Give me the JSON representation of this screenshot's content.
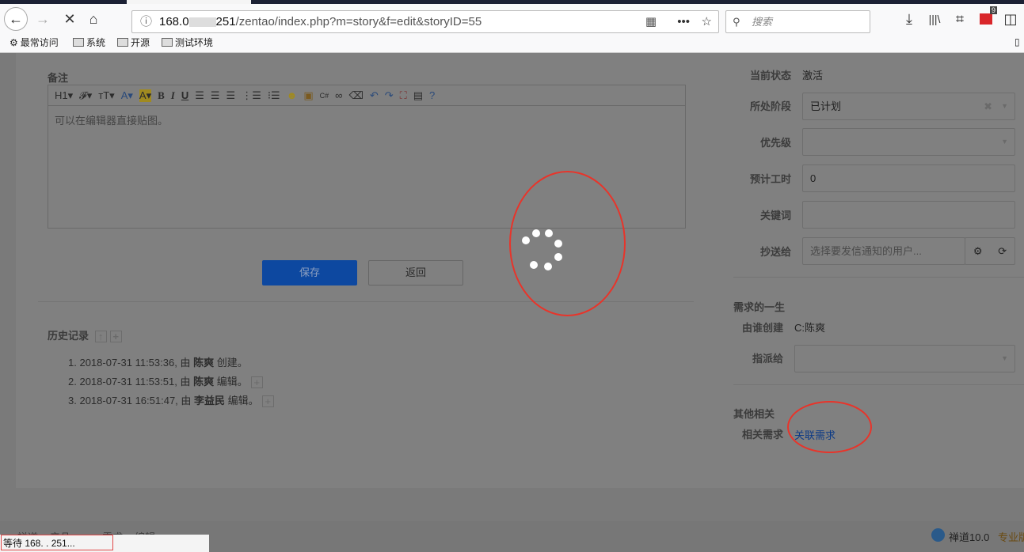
{
  "browser": {
    "url_host": "168.0",
    "url_host_end": "251",
    "url_path": "/zentao/index.php?m=story&f=edit&storyID=55",
    "search_placeholder": "搜索",
    "badge": "9",
    "bookmarks": [
      "最常访问",
      "系统",
      "开源",
      "测试环境"
    ],
    "status_text": "等待 168.   .  251..."
  },
  "editor": {
    "label": "备注",
    "placeholder": "可以在编辑器直接贴图。",
    "toolbar": [
      "H1▾",
      "𝓕▾",
      "тT▾",
      "A▾",
      "A▾",
      "B",
      "I",
      "U"
    ]
  },
  "buttons": {
    "save": "保存",
    "back": "返回"
  },
  "history": {
    "title": "历史记录",
    "items": [
      {
        "n": "1.",
        "time": "2018-07-31 11:53:36, 由",
        "user": "陈爽",
        "action": "创建。"
      },
      {
        "n": "2.",
        "time": "2018-07-31 11:53:51, 由",
        "user": "陈爽",
        "action": "编辑。"
      },
      {
        "n": "3.",
        "time": "2018-07-31 16:51:47, 由",
        "user": "李益民",
        "action": "编辑。"
      }
    ]
  },
  "side": {
    "status_label": "当前状态",
    "status_value": "激活",
    "stage_label": "所处阶段",
    "stage_value": "已计划",
    "priority_label": "优先级",
    "estimate_label": "预计工时",
    "estimate_value": "0",
    "keywords_label": "关键词",
    "mailto_label": "抄送给",
    "mailto_placeholder": "选择要发信通知的用户...",
    "life_title": "需求的一生",
    "creator_label": "由谁创建",
    "creator_value": "C:陈爽",
    "assign_label": "指派给",
    "other_title": "其他相关",
    "related_label": "相关需求",
    "related_link": "关联需求"
  },
  "footer": {
    "breadcrumb": "禅道 > 产品 > ... > 需求 > 编辑",
    "brand": "禅道10.0",
    "edition": "专业版"
  }
}
